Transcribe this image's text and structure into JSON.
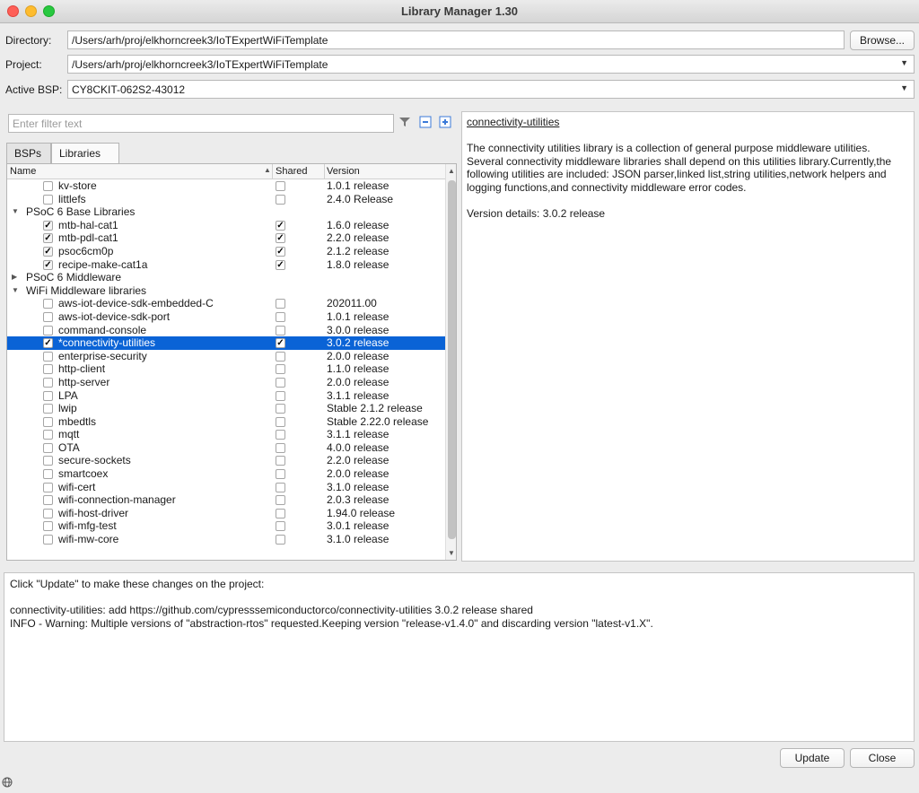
{
  "window": {
    "title": "Library Manager 1.30"
  },
  "directory": {
    "label": "Directory:",
    "value": "/Users/arh/proj/elkhorncreek3/IoTExpertWiFiTemplate",
    "browse_label": "Browse..."
  },
  "project": {
    "label": "Project:",
    "value": "/Users/arh/proj/elkhorncreek3/IoTExpertWiFiTemplate"
  },
  "bsp": {
    "label": "Active BSP:",
    "value": "CY8CKIT-062S2-43012"
  },
  "filter": {
    "placeholder": "Enter filter text"
  },
  "tabs": [
    {
      "label": "BSPs"
    },
    {
      "label": "Libraries"
    }
  ],
  "columns": {
    "name": "Name",
    "shared": "Shared",
    "version": "Version"
  },
  "rows": [
    {
      "type": "item",
      "name": "kv-store",
      "checked": false,
      "shared": false,
      "version": "1.0.1 release"
    },
    {
      "type": "item",
      "name": "littlefs",
      "checked": false,
      "shared": false,
      "version": "2.4.0 Release"
    },
    {
      "type": "group",
      "name": "PSoC 6 Base Libraries",
      "expanded": true
    },
    {
      "type": "item",
      "name": "mtb-hal-cat1",
      "checked": true,
      "locked": true,
      "shared": true,
      "version": "1.6.0 release"
    },
    {
      "type": "item",
      "name": "mtb-pdl-cat1",
      "checked": true,
      "locked": true,
      "shared": true,
      "version": "2.2.0 release"
    },
    {
      "type": "item",
      "name": "psoc6cm0p",
      "checked": true,
      "locked": true,
      "shared": true,
      "version": "2.1.2 release"
    },
    {
      "type": "item",
      "name": "recipe-make-cat1a",
      "checked": true,
      "locked": true,
      "shared": true,
      "version": "1.8.0 release"
    },
    {
      "type": "group",
      "name": "PSoC 6 Middleware",
      "expanded": false
    },
    {
      "type": "group",
      "name": "WiFi Middleware libraries",
      "expanded": true
    },
    {
      "type": "item",
      "name": "aws-iot-device-sdk-embedded-C",
      "checked": false,
      "shared": false,
      "version": "202011.00"
    },
    {
      "type": "item",
      "name": "aws-iot-device-sdk-port",
      "checked": false,
      "shared": false,
      "version": "1.0.1 release"
    },
    {
      "type": "item",
      "name": "command-console",
      "checked": false,
      "shared": false,
      "version": "3.0.0 release"
    },
    {
      "type": "item",
      "name": "*connectivity-utilities",
      "checked": true,
      "shared": true,
      "version": "3.0.2 release",
      "selected": true
    },
    {
      "type": "item",
      "name": "enterprise-security",
      "checked": false,
      "shared": false,
      "version": "2.0.0 release"
    },
    {
      "type": "item",
      "name": "http-client",
      "checked": false,
      "shared": false,
      "version": "1.1.0 release"
    },
    {
      "type": "item",
      "name": "http-server",
      "checked": false,
      "shared": false,
      "version": "2.0.0 release"
    },
    {
      "type": "item",
      "name": "LPA",
      "checked": false,
      "shared": false,
      "version": "3.1.1 release"
    },
    {
      "type": "item",
      "name": "lwip",
      "checked": false,
      "shared": false,
      "version": "Stable 2.1.2 release"
    },
    {
      "type": "item",
      "name": "mbedtls",
      "checked": false,
      "shared": false,
      "version": "Stable 2.22.0 release"
    },
    {
      "type": "item",
      "name": "mqtt",
      "checked": false,
      "shared": false,
      "version": "3.1.1 release"
    },
    {
      "type": "item",
      "name": "OTA",
      "checked": false,
      "shared": false,
      "version": "4.0.0 release"
    },
    {
      "type": "item",
      "name": "secure-sockets",
      "checked": false,
      "shared": false,
      "version": "2.2.0 release"
    },
    {
      "type": "item",
      "name": "smartcoex",
      "checked": false,
      "shared": false,
      "version": "2.0.0 release"
    },
    {
      "type": "item",
      "name": "wifi-cert",
      "checked": false,
      "shared": false,
      "version": "3.1.0 release"
    },
    {
      "type": "item",
      "name": "wifi-connection-manager",
      "checked": false,
      "shared": false,
      "version": "2.0.3 release"
    },
    {
      "type": "item",
      "name": "wifi-host-driver",
      "checked": false,
      "shared": false,
      "version": "1.94.0 release"
    },
    {
      "type": "item",
      "name": "wifi-mfg-test",
      "checked": false,
      "shared": false,
      "version": "3.0.1 release"
    },
    {
      "type": "item",
      "name": "wifi-mw-core",
      "checked": false,
      "shared": false,
      "version": "3.1.0 release"
    }
  ],
  "description": {
    "title": "connectivity-utilities",
    "body": "The connectivity utilities library is a collection of general purpose middleware utilities. Several connectivity middleware libraries shall depend on this utilities library.Currently,the following utilities are included: JSON parser,linked list,string utilities,network helpers and logging functions,and connectivity middleware error codes.",
    "version": "Version details: 3.0.2 release"
  },
  "log": {
    "line1": "Click \"Update\" to make these changes on the project:",
    "line2": "connectivity-utilities: add https://github.com/cypresssemiconductorco/connectivity-utilities 3.0.2 release shared",
    "line3": "INFO - Warning: Multiple versions of \"abstraction-rtos\" requested.Keeping version \"release-v1.4.0\" and discarding version \"latest-v1.X\"."
  },
  "buttons": {
    "update": "Update",
    "close": "Close"
  }
}
